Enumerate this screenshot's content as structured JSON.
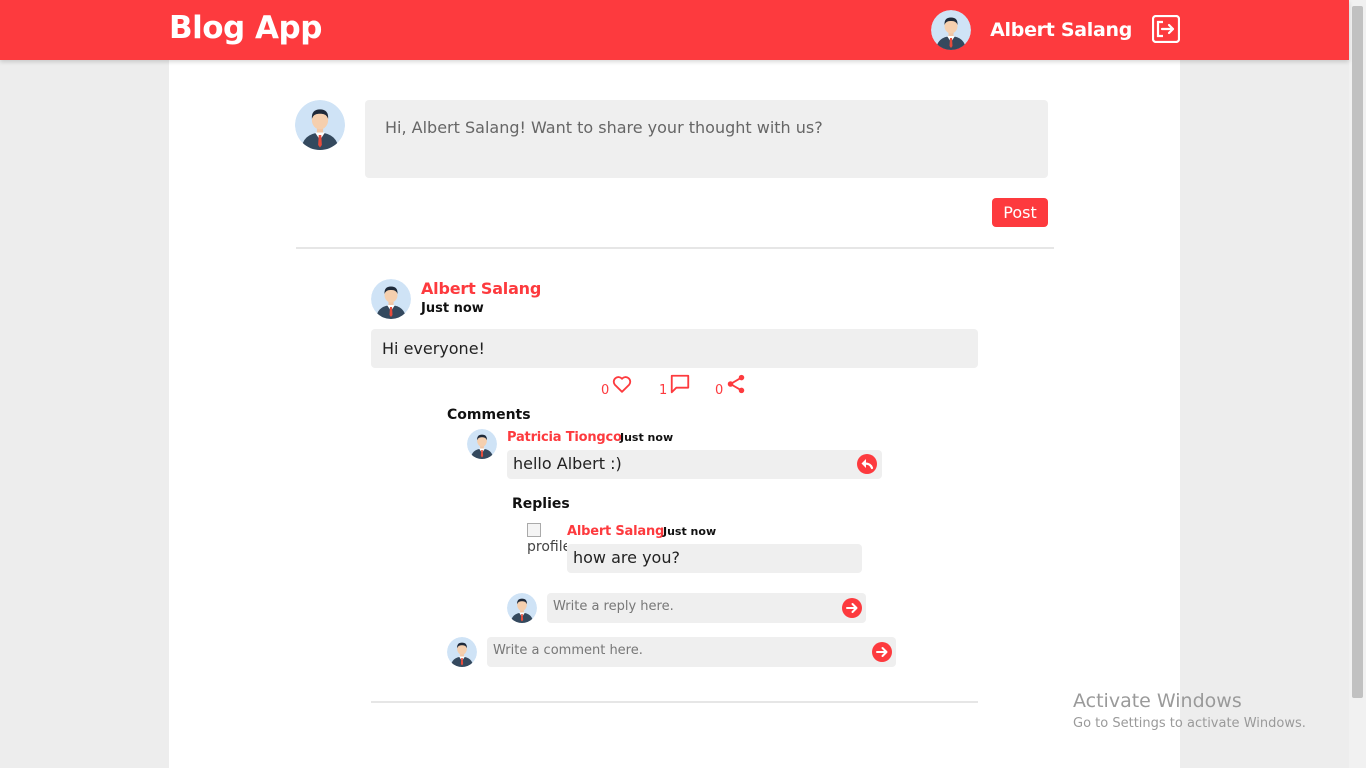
{
  "header": {
    "brand": "Blog App",
    "user_name": "Albert Salang",
    "logout_icon": "logout-icon"
  },
  "composer": {
    "placeholder": "Hi, Albert Salang! Want to share your thought with us?",
    "post_label": "Post"
  },
  "post": {
    "author": "Albert Salang",
    "time": "Just now",
    "body": "Hi everyone!",
    "likes": "0",
    "comments": "1",
    "shares": "0"
  },
  "comments": {
    "title": "Comments",
    "items": [
      {
        "author": "Patricia Tiongco",
        "time": "Just now",
        "body": "hello Albert :)",
        "replies_title": "Replies",
        "replies": [
          {
            "author": "Albert Salang",
            "time": "Just now",
            "body": "how are you?",
            "broken_image_alt": "profile"
          }
        ],
        "reply_placeholder": "Write a reply here."
      }
    ],
    "comment_placeholder": "Write a comment here."
  },
  "watermark": {
    "line1": "Activate Windows",
    "line2": "Go to Settings to activate Windows."
  },
  "colors": {
    "accent": "#fd3a3e",
    "input_bg": "#efefef",
    "page_bg": "#ededed"
  }
}
